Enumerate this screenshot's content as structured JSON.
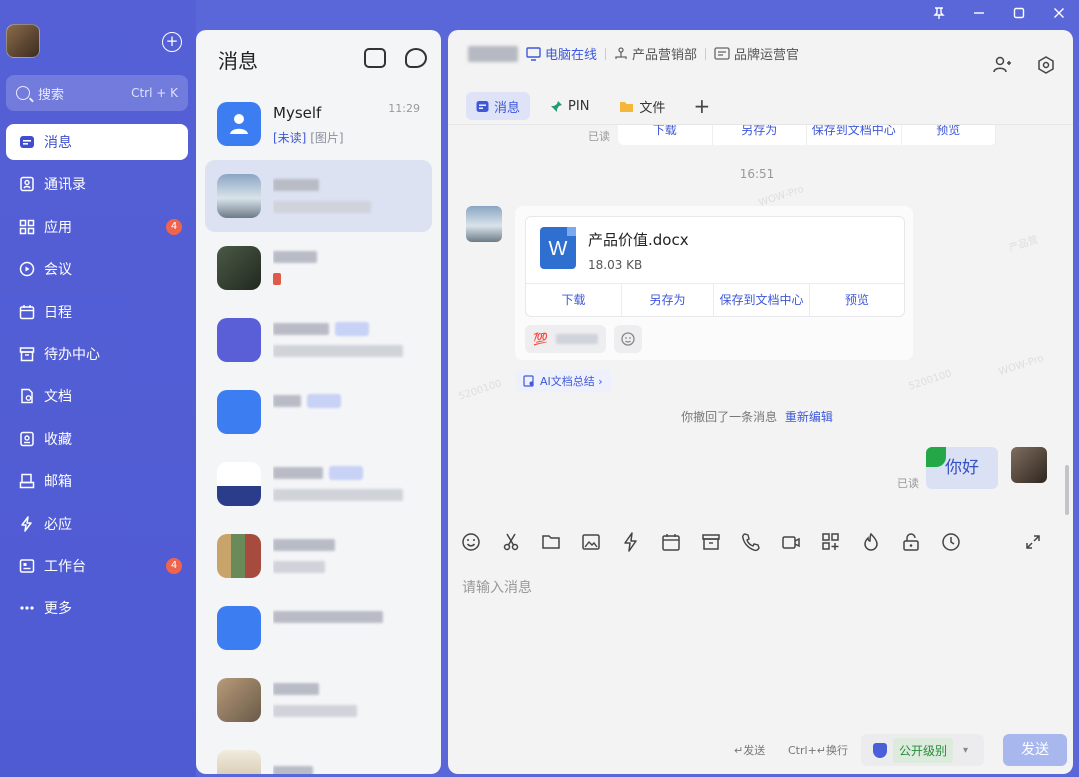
{
  "nav": {
    "search_placeholder": "搜索",
    "search_shortcut": "Ctrl + K",
    "items": [
      {
        "label": "消息",
        "icon": "message-icon",
        "active": true
      },
      {
        "label": "通讯录",
        "icon": "contacts-icon"
      },
      {
        "label": "应用",
        "icon": "apps-icon",
        "badge": "4"
      },
      {
        "label": "会议",
        "icon": "meeting-icon"
      },
      {
        "label": "日程",
        "icon": "calendar-icon"
      },
      {
        "label": "待办中心",
        "icon": "todo-icon"
      },
      {
        "label": "文档",
        "icon": "document-icon"
      },
      {
        "label": "收藏",
        "icon": "favorite-icon"
      },
      {
        "label": "邮箱",
        "icon": "mail-icon"
      },
      {
        "label": "必应",
        "icon": "ding-icon"
      },
      {
        "label": "工作台",
        "icon": "workbench-icon",
        "badge": "4"
      },
      {
        "label": "更多",
        "icon": "more-icon"
      }
    ]
  },
  "conversations": {
    "title": "消息",
    "items": [
      {
        "name": "Myself",
        "time": "11:29",
        "preview_tag": "[未读]",
        "preview": " [图片]"
      }
    ]
  },
  "chat": {
    "status_online": "电脑在线",
    "department": "产品营销部",
    "role": "品牌运营官",
    "tabs": [
      "消息",
      "PIN",
      "文件"
    ],
    "prev_card_actions": [
      "下载",
      "另存为",
      "保存到文档中心",
      "预览"
    ],
    "read_label": "已读",
    "timestamp": "16:51",
    "file": {
      "name": "产品价值.docx",
      "size": "18.03 KB",
      "icon_letter": "W"
    },
    "file_actions": [
      "下载",
      "另存为",
      "保存到文档中心",
      "预览"
    ],
    "reaction_emoji": "💯",
    "ai_summary": "AI文档总结 ›",
    "recall_text": "你撤回了一条消息",
    "recall_link": "重新编辑",
    "hello_text": "你好",
    "input_placeholder": "请输入消息",
    "send_hint": "↵发送",
    "newline_hint": "Ctrl+↵换行",
    "security_level": "公开级别",
    "send_label": "发送"
  },
  "colors": {
    "accent": "#3e58d9",
    "nav_bg": "#5560d6",
    "badge": "#f0634d",
    "send_disabled": "#a9b7ef"
  }
}
